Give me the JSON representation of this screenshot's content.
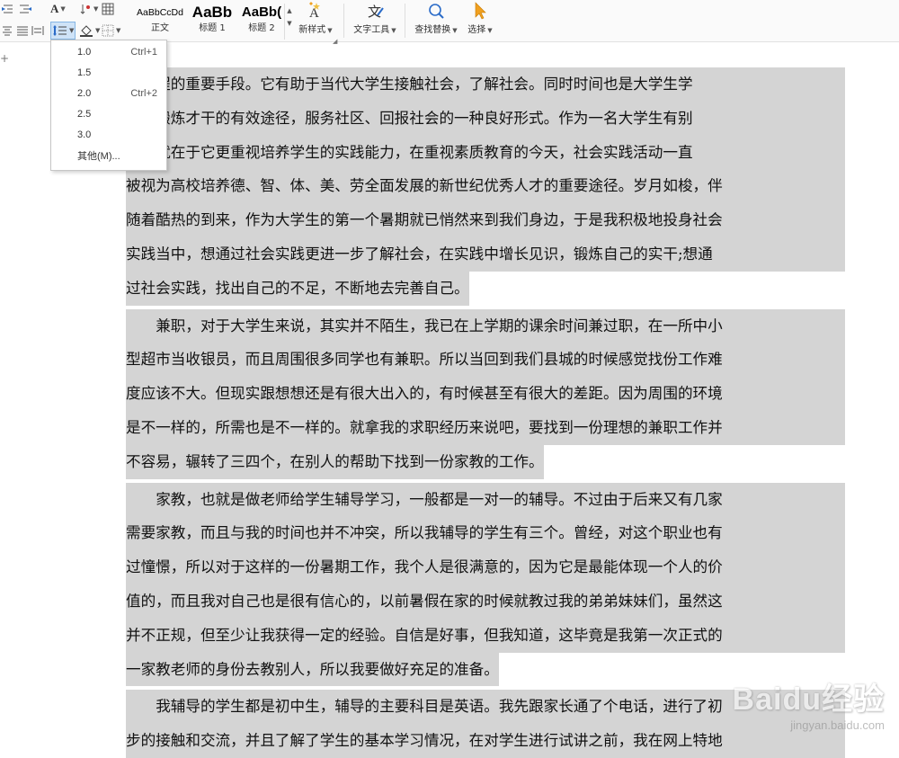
{
  "ribbon": {
    "font_grow_glyph": "A",
    "styles": [
      {
        "preview": "AaBbCcDd",
        "label": "正文"
      },
      {
        "preview": "AaBb",
        "label": "标题 1"
      },
      {
        "preview": "AaBb(",
        "label": "标题 2"
      }
    ],
    "new_style_label": "新样式",
    "text_tools_label": "文字工具",
    "find_replace_label": "查找替换",
    "select_label": "选择"
  },
  "line_spacing_menu": {
    "items": [
      {
        "value": "1.0",
        "shortcut": "Ctrl+1"
      },
      {
        "value": "1.5",
        "shortcut": ""
      },
      {
        "value": "2.0",
        "shortcut": "Ctrl+2"
      },
      {
        "value": "2.5",
        "shortcut": ""
      },
      {
        "value": "3.0",
        "shortcut": ""
      },
      {
        "value": "其他(M)...",
        "shortcut": ""
      }
    ]
  },
  "left_strip": {
    "plus_glyph": "+"
  },
  "document": {
    "paragraphs": [
      {
        "indent": false,
        "lines": [
          "育进程的重要手段。它有助于当代大学生接触社会，了解社会。同时时间也是大学生学",
          "识、锻炼才干的有效途径，服务社区、回报社会的一种良好形式。作为一名大学生有别",
          "学生就在于它更重视培养学生的实践能力，在重视素质教育的今天，社会实践活动一直",
          "被视为高校培养德、智、体、美、劳全面发展的新世纪优秀人才的重要途径。岁月如梭，伴",
          "随着酷热的到来，作为大学生的第一个暑期就已悄然来到我们身边，于是我积极地投身社会",
          "实践当中，想通过社会实践更进一步了解社会，在实践中增长见识，锻炼自己的实干;想通",
          "过社会实践，找出自己的不足，不断地去完善自己。"
        ]
      },
      {
        "indent": true,
        "lines": [
          "兼职，对于大学生来说，其实并不陌生，我已在上学期的课余时间兼过职，在一所中小",
          "型超市当收银员，而且周围很多同学也有兼职。所以当回到我们县城的时候感觉找份工作难",
          "度应该不大。但现实跟想想还是有很大出入的，有时候甚至有很大的差距。因为周围的环境",
          "是不一样的，所需也是不一样的。就拿我的求职经历来说吧，要找到一份理想的兼职工作并",
          "不容易，辗转了三四个，在别人的帮助下找到一份家教的工作。"
        ]
      },
      {
        "indent": true,
        "lines": [
          "家教，也就是做老师给学生辅导学习，一般都是一对一的辅导。不过由于后来又有几家",
          "需要家教，而且与我的时间也并不冲突，所以我辅导的学生有三个。曾经，对这个职业也有",
          "过憧憬，所以对于这样的一份暑期工作，我个人是很满意的，因为它是最能体现一个人的价",
          "值的，而且我对自己也是很有信心的，以前暑假在家的时候就教过我的弟弟妹妹们，虽然这",
          "并不正规，但至少让我获得一定的经验。自信是好事，但我知道，这毕竟是我第一次正式的",
          "一家教老师的身份去教别人，所以我要做好充足的准备。"
        ]
      },
      {
        "indent": true,
        "lines": [
          "我辅导的学生都是初中生，辅导的主要科目是英语。我先跟家长通了个电话，进行了初",
          "步的接触和交流，并且了解了学生的基本学习情况，在对学生进行试讲之前，我在网上特地"
        ]
      }
    ]
  },
  "watermark": {
    "logo": "Baidu经验",
    "url": "jingyan.baidu.com"
  },
  "colors": {
    "selection": "#d4d4d4",
    "active_button": "#cfe3f7",
    "accent": "#f0a020"
  }
}
